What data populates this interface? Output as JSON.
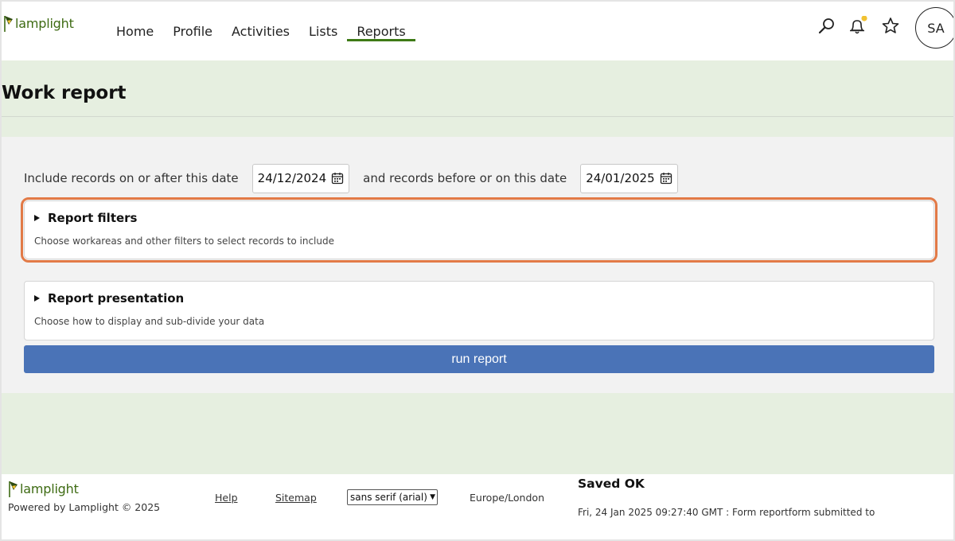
{
  "brand": {
    "name": "lamplight",
    "accent": "#3e7a16",
    "logo_color": "#3e6b13"
  },
  "nav": {
    "items": [
      {
        "label": "Home",
        "active": false
      },
      {
        "label": "Profile",
        "active": false
      },
      {
        "label": "Activities",
        "active": false
      },
      {
        "label": "Lists",
        "active": false
      },
      {
        "label": "Reports",
        "active": true
      }
    ]
  },
  "header_icons": [
    "search-icon",
    "notification-bell-icon",
    "favourite-star-icon"
  ],
  "notification_dot_color": "#f1c232",
  "user": {
    "initials": "SA"
  },
  "page": {
    "title": "Work report"
  },
  "dates": {
    "from_label": "Include records on or after this date",
    "from_value": "24/12/2024",
    "to_label": "and records before or on this date",
    "to_value": "24/01/2025"
  },
  "sections": [
    {
      "title": "Report filters",
      "description": "Choose workareas and other filters to select records to include",
      "highlighted": true
    },
    {
      "title": "Report presentation",
      "description": "Choose how to display and sub-divide your data",
      "highlighted": false
    }
  ],
  "run_button": {
    "label": "run report",
    "color": "#4a73b7"
  },
  "footer": {
    "brand": "lamplight",
    "powered_by": "Powered by Lamplight © 2025",
    "links": [
      "Help",
      "Sitemap"
    ],
    "font_select_value": "sans serif (arial)",
    "timezone": "Europe/London",
    "saved_title": "Saved OK",
    "saved_message": "Fri, 24 Jan 2025 09:27:40 GMT : Form reportform submitted to"
  },
  "highlight_color": "#e27a47"
}
